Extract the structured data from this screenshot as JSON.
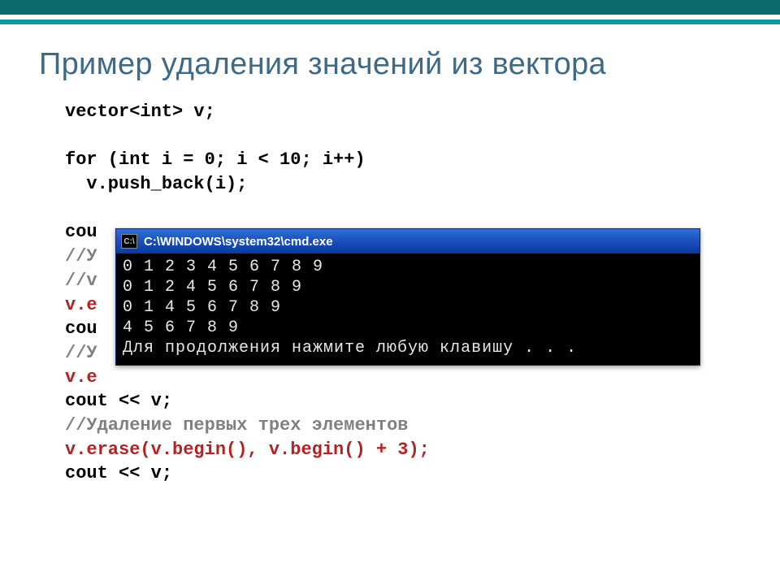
{
  "slide": {
    "title": "Пример удаления значений из вектора",
    "code": {
      "l01": "vector<int> v;",
      "l02": "",
      "l03": "for (int i = 0; i < 10; i++)",
      "l04": "  v.push_back(i);",
      "l05": "",
      "l06": "cou",
      "l07": "//У",
      "l08": "//v",
      "l09": "v.e",
      "l10": "cou",
      "l11": "//У",
      "l12": "v.e",
      "l13": "cout << v;",
      "l14": "//Удаление первых трех элементов",
      "l15": "v.erase(v.begin(), v.begin() + 3);",
      "l16": "cout << v;"
    }
  },
  "terminal": {
    "icon_label": "C:\\",
    "title": "C:\\WINDOWS\\system32\\cmd.exe",
    "lines": {
      "r1": "0 1 2 3 4 5 6 7 8 9",
      "r2": "0 1 2 4 5 6 7 8 9",
      "r3": "0 1 4 5 6 7 8 9",
      "r4": "4 5 6 7 8 9",
      "r5": "Для продолжения нажмите любую клавишу . . ."
    }
  }
}
